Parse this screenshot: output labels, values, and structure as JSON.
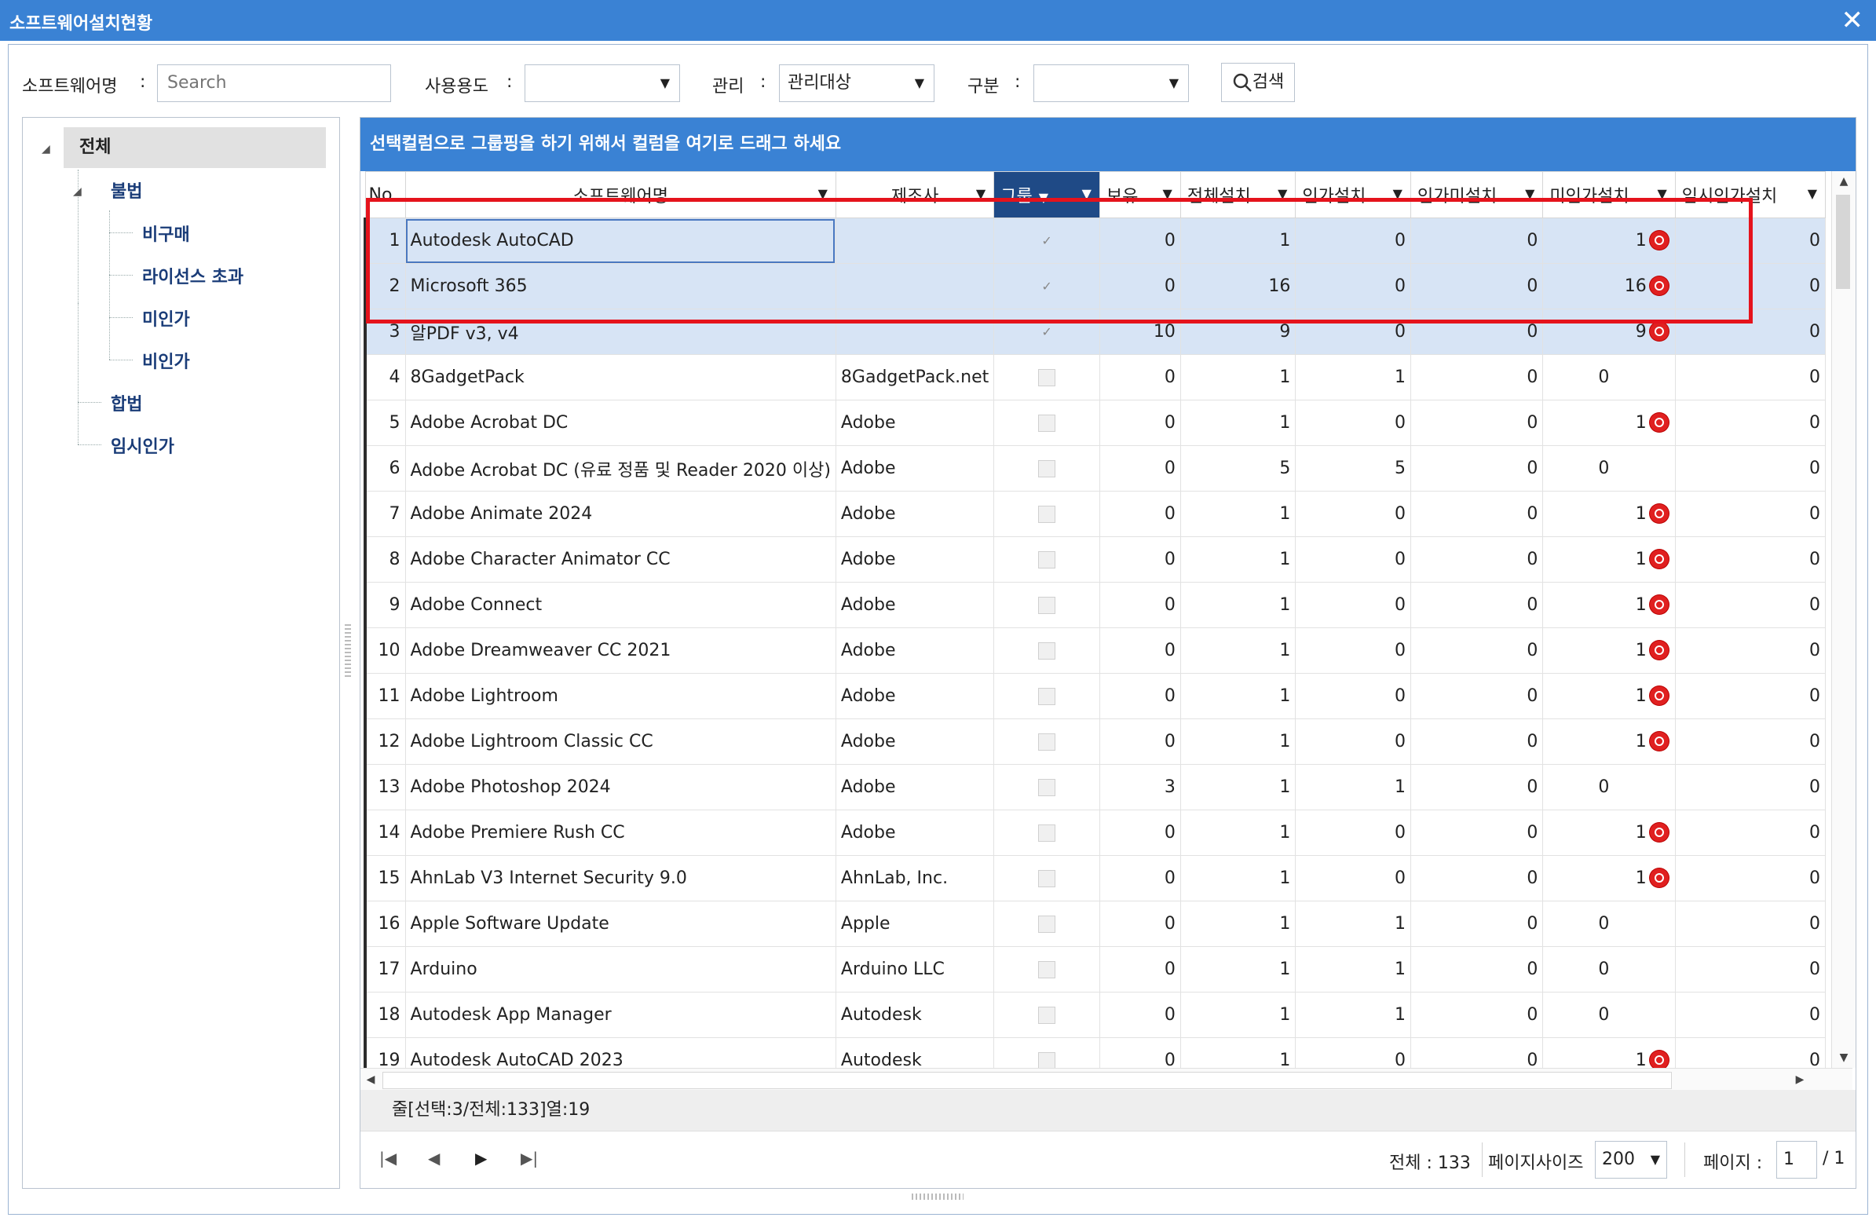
{
  "window": {
    "title": "소프트웨어설치현황",
    "close_glyph": "✕"
  },
  "filters": {
    "software_label": "소프트웨어명",
    "colon": ":",
    "software_placeholder": "Search",
    "usage_label": "사용용도",
    "usage_value": "",
    "manage_label": "관리",
    "manage_value": "관리대상",
    "category_label": "구분",
    "category_value": "",
    "search_button": "검색",
    "search_icon": "search-icon"
  },
  "tree": {
    "root": "전체",
    "illegal": "불법",
    "illegal_children": [
      "비구매",
      "라이선스 초과",
      "미인가",
      "비인가"
    ],
    "legal": "합법",
    "temporary": "임시인가"
  },
  "grid": {
    "group_bar": "선택컬럼으로 그룹핑을 하기 위해서 컬럼을 여기로 드래그 하세요",
    "columns": [
      "No",
      "소프트웨어명",
      "제조사",
      "그룹",
      "보유",
      "전체설치",
      "인가설치",
      "인가미설치",
      "미인가설치",
      "임시인가설치"
    ],
    "rows": [
      {
        "no": "1",
        "name": "Autodesk AutoCAD",
        "maker": "",
        "group": true,
        "own": "0",
        "total": "1",
        "auth": "0",
        "auth_missing": "0",
        "unauth": "1",
        "unauth_warn": true,
        "temp": "0",
        "selected": true
      },
      {
        "no": "2",
        "name": "Microsoft 365",
        "maker": "",
        "group": true,
        "own": "0",
        "total": "16",
        "auth": "0",
        "auth_missing": "0",
        "unauth": "16",
        "unauth_warn": true,
        "temp": "0",
        "selected": true
      },
      {
        "no": "3",
        "name": "알PDF v3, v4",
        "maker": "",
        "group": true,
        "own": "10",
        "total": "9",
        "auth": "0",
        "auth_missing": "0",
        "unauth": "9",
        "unauth_warn": true,
        "temp": "0",
        "selected": true
      },
      {
        "no": "4",
        "name": "8GadgetPack",
        "maker": "8GadgetPack.net",
        "group": false,
        "own": "0",
        "total": "1",
        "auth": "1",
        "auth_missing": "0",
        "unauth": "0",
        "unauth_warn": false,
        "temp": "0",
        "selected": false
      },
      {
        "no": "5",
        "name": "Adobe Acrobat DC",
        "maker": "Adobe",
        "group": false,
        "own": "0",
        "total": "1",
        "auth": "0",
        "auth_missing": "0",
        "unauth": "1",
        "unauth_warn": true,
        "temp": "0",
        "selected": false
      },
      {
        "no": "6",
        "name": "Adobe Acrobat DC (유료 정품 및 Reader 2020 이상)",
        "maker": "Adobe",
        "group": false,
        "own": "0",
        "total": "5",
        "auth": "5",
        "auth_missing": "0",
        "unauth": "0",
        "unauth_warn": false,
        "temp": "0",
        "selected": false
      },
      {
        "no": "7",
        "name": "Adobe Animate 2024",
        "maker": "Adobe",
        "group": false,
        "own": "0",
        "total": "1",
        "auth": "0",
        "auth_missing": "0",
        "unauth": "1",
        "unauth_warn": true,
        "temp": "0",
        "selected": false
      },
      {
        "no": "8",
        "name": "Adobe Character Animator CC",
        "maker": "Adobe",
        "group": false,
        "own": "0",
        "total": "1",
        "auth": "0",
        "auth_missing": "0",
        "unauth": "1",
        "unauth_warn": true,
        "temp": "0",
        "selected": false
      },
      {
        "no": "9",
        "name": "Adobe Connect",
        "maker": "Adobe",
        "group": false,
        "own": "0",
        "total": "1",
        "auth": "0",
        "auth_missing": "0",
        "unauth": "1",
        "unauth_warn": true,
        "temp": "0",
        "selected": false
      },
      {
        "no": "10",
        "name": "Adobe Dreamweaver CC 2021",
        "maker": "Adobe",
        "group": false,
        "own": "0",
        "total": "1",
        "auth": "0",
        "auth_missing": "0",
        "unauth": "1",
        "unauth_warn": true,
        "temp": "0",
        "selected": false
      },
      {
        "no": "11",
        "name": "Adobe Lightroom",
        "maker": "Adobe",
        "group": false,
        "own": "0",
        "total": "1",
        "auth": "0",
        "auth_missing": "0",
        "unauth": "1",
        "unauth_warn": true,
        "temp": "0",
        "selected": false
      },
      {
        "no": "12",
        "name": "Adobe Lightroom Classic CC",
        "maker": "Adobe",
        "group": false,
        "own": "0",
        "total": "1",
        "auth": "0",
        "auth_missing": "0",
        "unauth": "1",
        "unauth_warn": true,
        "temp": "0",
        "selected": false
      },
      {
        "no": "13",
        "name": "Adobe Photoshop 2024",
        "maker": "Adobe",
        "group": false,
        "own": "3",
        "total": "1",
        "auth": "1",
        "auth_missing": "0",
        "unauth": "0",
        "unauth_warn": false,
        "temp": "0",
        "selected": false
      },
      {
        "no": "14",
        "name": "Adobe Premiere Rush CC",
        "maker": "Adobe",
        "group": false,
        "own": "0",
        "total": "1",
        "auth": "0",
        "auth_missing": "0",
        "unauth": "1",
        "unauth_warn": true,
        "temp": "0",
        "selected": false
      },
      {
        "no": "15",
        "name": "AhnLab V3 Internet Security 9.0",
        "maker": "AhnLab, Inc.",
        "group": false,
        "own": "0",
        "total": "1",
        "auth": "0",
        "auth_missing": "0",
        "unauth": "1",
        "unauth_warn": true,
        "temp": "0",
        "selected": false
      },
      {
        "no": "16",
        "name": "Apple Software Update",
        "maker": "Apple",
        "group": false,
        "own": "0",
        "total": "1",
        "auth": "1",
        "auth_missing": "0",
        "unauth": "0",
        "unauth_warn": false,
        "temp": "0",
        "selected": false
      },
      {
        "no": "17",
        "name": "Arduino",
        "maker": "Arduino LLC",
        "group": false,
        "own": "0",
        "total": "1",
        "auth": "1",
        "auth_missing": "0",
        "unauth": "0",
        "unauth_warn": false,
        "temp": "0",
        "selected": false
      },
      {
        "no": "18",
        "name": "Autodesk App Manager",
        "maker": "Autodesk",
        "group": false,
        "own": "0",
        "total": "1",
        "auth": "1",
        "auth_missing": "0",
        "unauth": "0",
        "unauth_warn": false,
        "temp": "0",
        "selected": false
      },
      {
        "no": "19",
        "name": "Autodesk AutoCAD 2023",
        "maker": "Autodesk",
        "group": false,
        "own": "0",
        "total": "1",
        "auth": "0",
        "auth_missing": "0",
        "unauth": "1",
        "unauth_warn": true,
        "temp": "0",
        "selected": false
      }
    ],
    "status_text": "줄[선택:3/전체:133]열:19",
    "total_label": "전체 : 133",
    "page_size_label": "페이지사이즈",
    "page_size": "200",
    "page_label": "페이지 :",
    "page_current": "1",
    "page_total": "/ 1",
    "icons": {
      "first": "first-page-icon",
      "prev": "prev-page-icon",
      "next": "next-page-icon",
      "last": "last-page-icon",
      "warn": "warning-icon",
      "filter": "filter-icon"
    }
  },
  "colors": {
    "title_bar": "#3a82d4",
    "group_bar": "#3a82d4",
    "active_header": "#1f4a86",
    "selected_row": "#d7e4f5",
    "highlight": "#e5131c",
    "warn": "#e02020"
  }
}
